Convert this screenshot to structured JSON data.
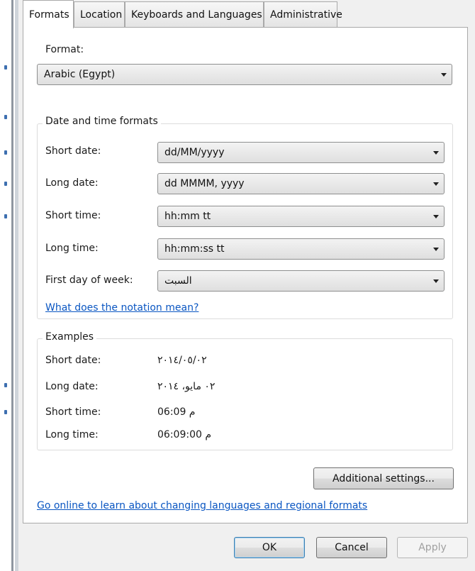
{
  "tabs": [
    {
      "label": "Formats",
      "active": true
    },
    {
      "label": "Location",
      "active": false
    },
    {
      "label": "Keyboards and Languages",
      "active": false
    },
    {
      "label": "Administrative",
      "active": false
    }
  ],
  "format": {
    "label": "Format:",
    "selected": "Arabic (Egypt)"
  },
  "date_time": {
    "title": "Date and time formats",
    "rows": [
      {
        "label": "Short date:",
        "value": "dd/MM/yyyy"
      },
      {
        "label": "Long date:",
        "value": "dd MMMM, yyyy"
      },
      {
        "label": "Short time:",
        "value": "hh:mm tt"
      },
      {
        "label": "Long time:",
        "value": "hh:mm:ss tt"
      },
      {
        "label": "First day of week:",
        "value": "السبت"
      }
    ],
    "notation_link": "What does the notation mean?"
  },
  "examples": {
    "title": "Examples",
    "rows": [
      {
        "label": "Short date:",
        "value": "٢٠١٤/٠٥/٠٢"
      },
      {
        "label": "Long date:",
        "value": "٠٢ مايو، ٢٠١٤"
      },
      {
        "label": "Short time:",
        "value": "06:09 م"
      },
      {
        "label": "Long time:",
        "value": "06:09:00 م"
      }
    ]
  },
  "additional_settings_label": "Additional settings...",
  "online_link": "Go online to learn about changing languages and regional formats",
  "footer": {
    "ok_label": "OK",
    "cancel_label": "Cancel",
    "apply_label": "Apply"
  },
  "colors": {
    "link": "#0a56c2",
    "panel_border": "#a9a9a9",
    "dialog_bg": "#f0f0f0"
  }
}
